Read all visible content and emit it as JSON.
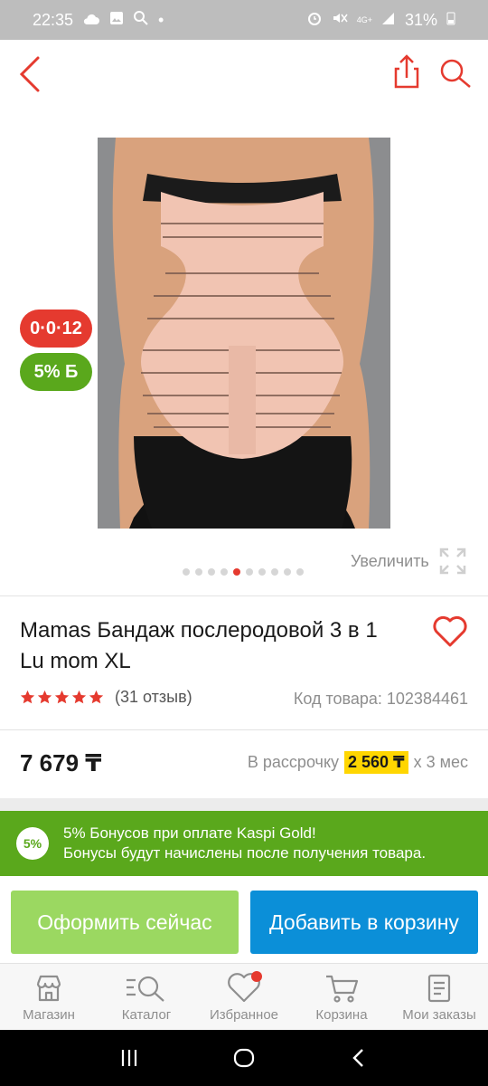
{
  "status_bar": {
    "time": "22:35",
    "battery": "31%",
    "network": "4G+"
  },
  "top_bar": {
    "back_icon": "chevron-left-icon",
    "share_icon": "share-icon",
    "search_icon": "search-icon"
  },
  "badges": {
    "installment": "0·0·12",
    "bonus": "5% Б"
  },
  "gallery": {
    "zoom_label": "Увеличить",
    "dot_count": 10,
    "active_dot": 4
  },
  "product": {
    "title": "Mamas Бандаж послеродовой 3 в 1 Lu mom XL",
    "rating": 5,
    "reviews": "(31 отзыв)",
    "code": "Код товара: 102384461",
    "price": "7 679 ₸",
    "installment_prefix": "В рассрочку",
    "installment_amount": "2 560 ₸",
    "installment_suffix": "x 3 мес"
  },
  "bonus_banner": {
    "badge": "5%",
    "line1": "5% Бонусов при оплате Kaspi Gold!",
    "line2": "Бонусы будут начислены после получения товара."
  },
  "actions": {
    "checkout": "Оформить сейчас",
    "add_to_cart": "Добавить в корзину"
  },
  "bottom_nav": [
    {
      "label": "Магазин",
      "icon": "store-icon"
    },
    {
      "label": "Каталог",
      "icon": "catalog-icon"
    },
    {
      "label": "Избранное",
      "icon": "heart-icon"
    },
    {
      "label": "Корзина",
      "icon": "cart-icon"
    },
    {
      "label": "Мои заказы",
      "icon": "orders-icon"
    }
  ],
  "colors": {
    "accent_red": "#e53a2f",
    "bonus_green": "#5aa81c",
    "checkout_green": "#9bd861",
    "cart_blue": "#0b8fd8",
    "installment_yellow": "#ffd600"
  }
}
